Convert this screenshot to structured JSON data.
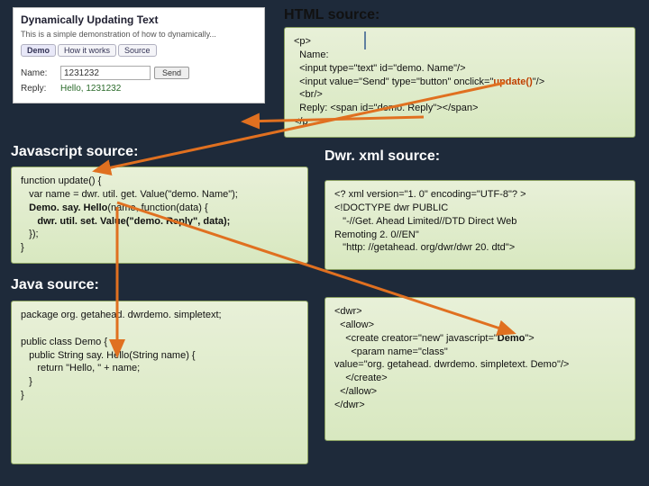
{
  "titles": {
    "html": "HTML source:",
    "js": "Javascript source:",
    "java": "Java source:",
    "dwr": "Dwr. xml source:"
  },
  "screenshot": {
    "title": "Dynamically Updating Text",
    "desc": "This is a simple demonstration of how to dynamically...",
    "tabs": [
      "Demo",
      "How it works",
      "Source"
    ],
    "name_label": "Name:",
    "name_value": "1231232",
    "send_btn": "Send",
    "reply_label": "Reply:",
    "reply_value": "Hello, 1231232"
  },
  "html_src": {
    "l1": "<p>",
    "l2": "  Name:",
    "l3": "  <input type=\"text\" id=\"demo. Name\"/>",
    "l4a": "  <input value=\"Send\" type=\"button\" onclick=\"",
    "l4b": "update()",
    "l4c": "\"/>",
    "l5": "  <br/>",
    "l6": "  Reply: <span id=\"demo. Reply\"></span>",
    "l7": "</p"
  },
  "js_src": {
    "l1": "function update() {",
    "l2": "   var name = dwr. util. get. Value(\"demo. Name\");",
    "l3a": "   ",
    "l3b": "Demo. say. Hello",
    "l3c": "(name, function(data) {",
    "l4a": "      ",
    "l4b": "dwr. util. set. Value(\"demo. Reply\", data);",
    "l5": "   });",
    "l6": "}"
  },
  "java_src": {
    "l1": "package org. getahead. dwrdemo. simpletext;",
    "l2": "",
    "l3": "public class Demo {",
    "l4": "   public String say. Hello(String name) {",
    "l5": "      return \"Hello, \" + name;",
    "l6": "   }",
    "l7": "}"
  },
  "dwr1": {
    "l1": "<? xml version=\"1. 0\" encoding=\"UTF-8\"? >",
    "l2": "<!DOCTYPE dwr PUBLIC",
    "l3": "   \"-//Get. Ahead Limited//DTD Direct Web",
    "l4": "Remoting 2. 0//EN\"",
    "l5": "   \"http: //getahead. org/dwr/dwr 20. dtd\">"
  },
  "dwr2": {
    "l1": "<dwr>",
    "l2": "  <allow>",
    "l3a": "    <create creator=\"new\" javascript=\"",
    "l3b": "Demo",
    "l3c": "\">",
    "l4": "      <param name=\"class\"",
    "l5": "value=\"org. getahead. dwrdemo. simpletext. Demo\"/>",
    "l6": "    </create>",
    "l7": "  </allow>",
    "l8": "</dwr>"
  }
}
